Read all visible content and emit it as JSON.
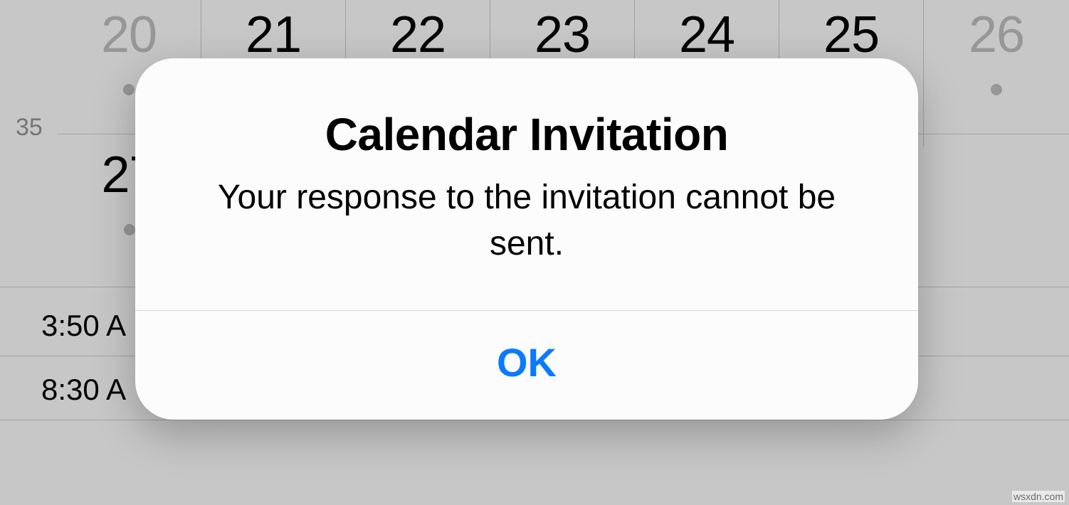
{
  "calendar": {
    "week_label": "35",
    "row1_days": [
      {
        "num": "20",
        "dim": true,
        "dot": true
      },
      {
        "num": "21",
        "dim": false,
        "dot": false
      },
      {
        "num": "22",
        "dim": false,
        "dot": false
      },
      {
        "num": "23",
        "dim": false,
        "dot": false
      },
      {
        "num": "24",
        "dim": false,
        "dot": false
      },
      {
        "num": "25",
        "dim": false,
        "dot": false
      },
      {
        "num": "26",
        "dim": true,
        "dot": true
      }
    ],
    "row2_day": {
      "num": "27",
      "dot": true
    },
    "times": [
      "3:50 A",
      "8:30 A"
    ]
  },
  "alert": {
    "title": "Calendar Invitation",
    "message": "Your response to the invitation cannot be sent.",
    "ok_label": "OK"
  },
  "watermark": "wsxdn.com"
}
